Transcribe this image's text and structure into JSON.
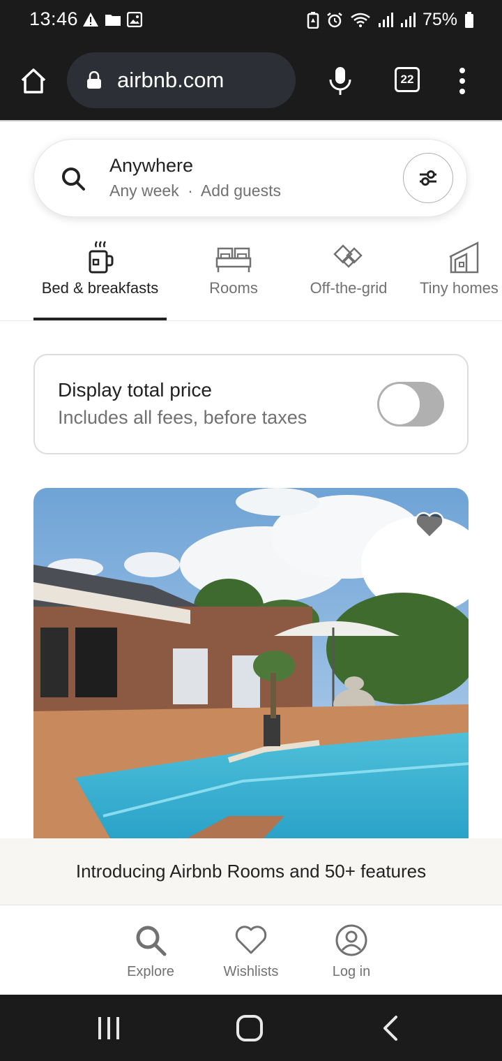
{
  "status_bar": {
    "time": "13:46",
    "battery_percent": "75%",
    "left_icons": [
      "warning-icon",
      "folder-icon",
      "image-icon"
    ],
    "right_icons": [
      "battery-saver-icon",
      "alarm-icon",
      "wifi-icon",
      "signal-icon",
      "signal-icon",
      "battery-icon"
    ]
  },
  "browser": {
    "url": "airbnb.com",
    "tab_count": "22",
    "icons": [
      "home-icon",
      "lock-icon",
      "mic-icon",
      "tabs-icon",
      "more-vert-icon"
    ]
  },
  "search": {
    "title": "Anywhere",
    "subtitle_week": "Any week",
    "separator": "·",
    "subtitle_guests": "Add guests",
    "icons": [
      "search-icon",
      "filter-icon"
    ]
  },
  "categories": [
    {
      "label": "Bed & breakfasts",
      "icon": "bed-breakfast-icon",
      "active": true
    },
    {
      "label": "Rooms",
      "icon": "rooms-icon",
      "active": false
    },
    {
      "label": "Off-the-grid",
      "icon": "off-the-grid-icon",
      "active": false
    },
    {
      "label": "Tiny homes",
      "icon": "tiny-home-icon",
      "active": false
    }
  ],
  "price_toggle": {
    "title": "Display total price",
    "subtitle": "Includes all fees, before taxes",
    "enabled": false
  },
  "listing": {
    "image": "house-with-pool-photo",
    "wishlist_icon": "heart-icon"
  },
  "banner": {
    "text": "Introducing Airbnb Rooms and 50+ features"
  },
  "bottom_nav": [
    {
      "label": "Explore",
      "icon": "search-icon"
    },
    {
      "label": "Wishlists",
      "icon": "heart-outline-icon"
    },
    {
      "label": "Log in",
      "icon": "profile-icon"
    }
  ],
  "system_nav": [
    "recents-icon",
    "home-icon",
    "back-icon"
  ],
  "colors": {
    "text_primary": "#222222",
    "text_secondary": "#717171",
    "toggle_off": "#b0b0b0",
    "browser_bg": "#1b1b1b",
    "url_pill": "#2c2f36"
  }
}
